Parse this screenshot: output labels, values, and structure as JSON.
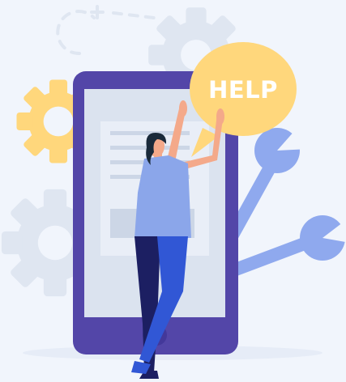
{
  "illustration": {
    "speech_bubble_text": "HELP",
    "colors": {
      "background": "#f1f5fc",
      "gear_gray": "#dfe6f1",
      "gear_yellow": "#ffd77c",
      "phone_frame": "#5346a8",
      "phone_screen": "#dbe3ef",
      "wrench_blue": "#8fa9ee",
      "bubble_yellow": "#ffd77c",
      "shirt_blue": "#8ba6ea",
      "pants_navy": "#1c1f62",
      "pants_blue": "#3157d5",
      "skin": "#f4a98a",
      "hair": "#1a2a3a"
    },
    "icons": [
      "gear-icon-gray-top",
      "gear-icon-gray-left",
      "gear-icon-yellow",
      "wrench-icon-upper",
      "wrench-icon-lower",
      "dashed-orbit-icon"
    ]
  }
}
